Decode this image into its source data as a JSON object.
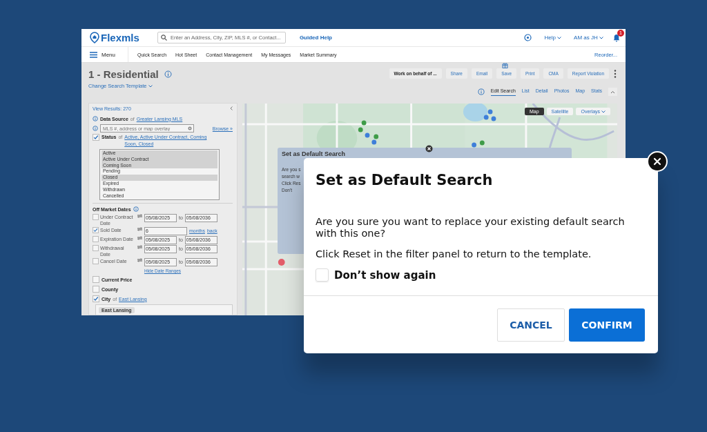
{
  "app": {
    "logo": "Flexmls",
    "search_placeholder": "Enter an Address, City, ZIP, MLS #, or Contact...",
    "guided_help": "Guided Help",
    "help": "Help",
    "user": "AM as JH",
    "notification_count": "1"
  },
  "nav": {
    "menu": "Menu",
    "items": [
      "Quick Search",
      "Hot Sheet",
      "Contact Management",
      "My Messages",
      "Market Summary"
    ],
    "reorder": "Reorder..."
  },
  "page": {
    "title": "1 - Residential",
    "template_link": "Change Search Template",
    "actions": [
      "Work on behalf of ...",
      "Share",
      "Email",
      "Save",
      "Print",
      "CMA",
      "Report Violation"
    ],
    "tabs": [
      {
        "label": "Edit Search",
        "selected": true
      },
      {
        "label": "List",
        "selected": false
      },
      {
        "label": "Detail",
        "selected": false
      },
      {
        "label": "Photos",
        "selected": false
      },
      {
        "label": "Map",
        "selected": false
      },
      {
        "label": "Stats",
        "selected": false
      }
    ]
  },
  "filters": {
    "view_results": "View Results: 270",
    "data_source": {
      "label": "Data Source",
      "of": "of",
      "value": "Greater Lansing MLS"
    },
    "mls_placeholder": "MLS #, address or map overlay",
    "browse": "Browse »",
    "status": {
      "label": "Status",
      "checked": true,
      "of": "of",
      "value": "Active, Active Under Contract, Coming Soon, Closed",
      "options": [
        {
          "label": "Active",
          "selected": true
        },
        {
          "label": "Active Under Contract",
          "selected": true
        },
        {
          "label": "Coming Soon",
          "selected": true
        },
        {
          "label": "Pending",
          "selected": false
        },
        {
          "label": "Closed",
          "selected": true
        },
        {
          "label": "Expired",
          "selected": false
        },
        {
          "label": "Withdrawn",
          "selected": false
        },
        {
          "label": "Cancelled",
          "selected": false
        }
      ]
    },
    "off_market": {
      "title": "Off Market Dates",
      "rows": [
        {
          "kind": "range",
          "label": "Under Contract Date",
          "checked": false,
          "from": "05/08/2025",
          "to": "to",
          "until": "05/08/2036"
        },
        {
          "kind": "relative",
          "label": "Sold Date",
          "checked": true,
          "value": "6",
          "unit": "months",
          "direction": "back"
        },
        {
          "kind": "range",
          "label": "Expiration Date",
          "checked": false,
          "from": "05/08/2025",
          "to": "to",
          "until": "05/08/2036"
        },
        {
          "kind": "range",
          "label": "Withdrawal Date",
          "checked": false,
          "from": "05/08/2025",
          "to": "to",
          "until": "05/08/2036"
        },
        {
          "kind": "range",
          "label": "Cancel Date",
          "checked": false,
          "from": "05/08/2025",
          "to": "to",
          "until": "05/08/2036"
        }
      ],
      "hide": "Hide Date Ranges"
    },
    "fields": [
      {
        "label": "Current Price",
        "checked": false
      },
      {
        "label": "County",
        "checked": false
      },
      {
        "label": "City",
        "checked": true,
        "of": "of",
        "value": "East Lansing"
      }
    ],
    "city_tag": "East Lansing"
  },
  "map": {
    "types": [
      {
        "label": "Map",
        "selected": true
      },
      {
        "label": "Satellite",
        "selected": false
      }
    ],
    "overlays": "Overlays"
  },
  "ghost_dialog": {
    "title": "Set as Default Search",
    "lines": [
      "Are you s",
      "search w",
      "Click Res",
      "Don't"
    ]
  },
  "dialog": {
    "title": "Set as Default Search",
    "message": "Are you sure you want to replace your existing default search with this one?",
    "hint": "Click Reset in the filter panel to return to the template.",
    "dont_show": {
      "label": "Don’t show again",
      "checked": false
    },
    "cancel": "CANCEL",
    "confirm": "CONFIRM"
  }
}
